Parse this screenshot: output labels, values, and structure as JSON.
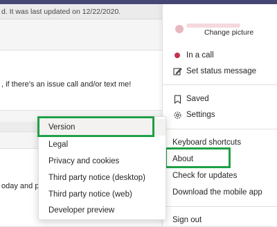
{
  "chat": {
    "notice": "d. It was last updated on 12/22/2020.",
    "message1": ", if there's an issue call and/or text me!",
    "message2": "oday and p"
  },
  "profile": {
    "change_picture": "Change picture",
    "items": [
      {
        "label": "In a call",
        "icon": "red-status-dot"
      },
      {
        "label": "Set status message",
        "icon": "edit-icon"
      },
      {
        "label": "Saved",
        "icon": "bookmark-icon"
      },
      {
        "label": "Settings",
        "icon": "gear-icon"
      },
      {
        "label": "Keyboard shortcuts"
      },
      {
        "label": "About"
      },
      {
        "label": "Check for updates"
      },
      {
        "label": "Download the mobile app"
      },
      {
        "label": "Sign out"
      }
    ]
  },
  "about_submenu": {
    "items": [
      {
        "label": "Version"
      },
      {
        "label": "Legal"
      },
      {
        "label": "Privacy and cookies"
      },
      {
        "label": "Third party notice (desktop)"
      },
      {
        "label": "Third party notice (web)"
      },
      {
        "label": "Developer preview"
      }
    ]
  },
  "colors": {
    "highlight": "#1fa044",
    "status_red": "#c4314b",
    "top_bar": "#464775"
  }
}
